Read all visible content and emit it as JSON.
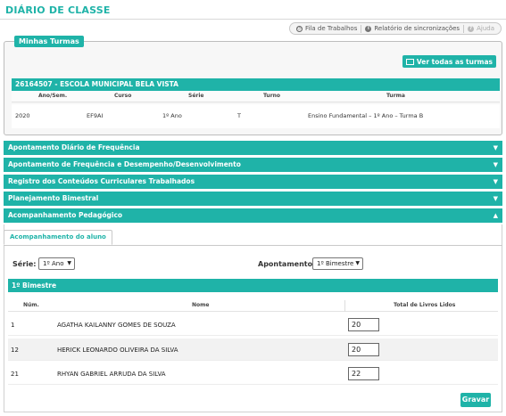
{
  "header": {
    "title": "DIÁRIO DE CLASSE"
  },
  "toolbar": {
    "fila": "Fila de Trabalhos",
    "relatorio": "Relatório de sincronizações",
    "ajuda": "Ajuda"
  },
  "turmas": {
    "legend": "Minhas Turmas",
    "ver_todas": "Ver todas as turmas",
    "school": "26164507 - ESCOLA MUNICIPAL BELA VISTA",
    "columns": [
      "Ano/Sem.",
      "Curso",
      "Série",
      "Turno",
      "Turma"
    ],
    "row": [
      "2020",
      "EF9AI",
      "1º Ano",
      "T",
      "Ensino Fundamental – 1º Ano – Turma B"
    ]
  },
  "accordion": [
    {
      "label": "Apontamento Diário de Frequência",
      "arrow": "▼"
    },
    {
      "label": "Apontamento de Frequência e Desempenho/Desenvolvimento",
      "arrow": "▼"
    },
    {
      "label": "Registro dos Conteúdos Curriculares Trabalhados",
      "arrow": "▼"
    },
    {
      "label": "Planejamento Bimestral",
      "arrow": "▼"
    },
    {
      "label": "Acompanhamento Pedagógico",
      "arrow": "▲"
    }
  ],
  "acomp": {
    "tab": "Acompanhamento do aluno",
    "serie_label": "Série:",
    "serie_value": "1º Ano",
    "apont_label": "Apontamento:",
    "apont_value": "1º Bimestre",
    "bimestre_bar": "1º Bimestre",
    "columns": [
      "Núm.",
      "Nome",
      "Total de Livros Lidos"
    ],
    "students": [
      {
        "num": "1",
        "name": "AGATHA KAILANNY GOMES DE SOUZA",
        "total": "20"
      },
      {
        "num": "12",
        "name": "HERICK LEONARDO OLIVEIRA DA SILVA",
        "total": "20"
      },
      {
        "num": "21",
        "name": "RHYAN GABRIEL ARRUDA DA SILVA",
        "total": "22"
      }
    ],
    "save": "Gravar"
  },
  "colors": {
    "accent": "#1fb3a8"
  }
}
